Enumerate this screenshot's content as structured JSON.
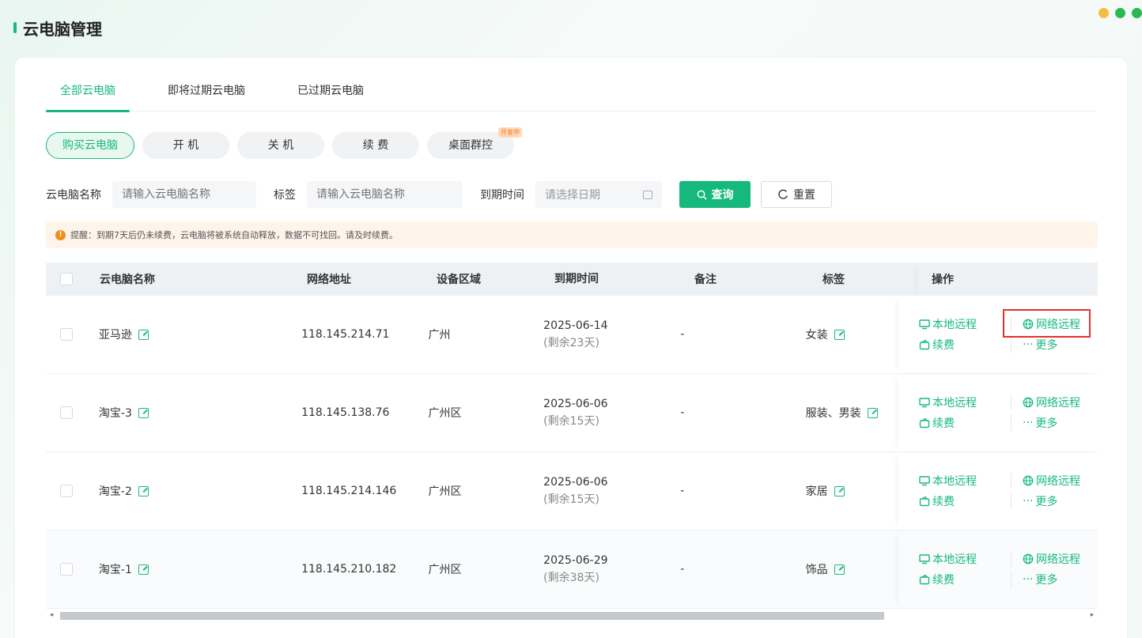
{
  "page_title": "云电脑管理",
  "window_dots": [
    "#f6bd44",
    "#2ab950",
    "#2ab950"
  ],
  "accent": "#16b97d",
  "tabs": [
    {
      "label": "全部云电脑",
      "active": true
    },
    {
      "label": "即将过期云电脑",
      "active": false
    },
    {
      "label": "已过期云电脑",
      "active": false
    }
  ],
  "actions": {
    "buy": "购买云电脑",
    "power_on": "开 机",
    "power_off": "关 机",
    "renew": "续 费",
    "desktop_group": "桌面群控",
    "dev_badge": "开发中"
  },
  "filters": {
    "name_label": "云电脑名称",
    "name_placeholder": "请输入云电脑名称",
    "tag_label": "标签",
    "tag_placeholder": "请输入云电脑名称",
    "expire_label": "到期时间",
    "expire_placeholder": "请选择日期",
    "search_button": "查询",
    "reset_button": "重置"
  },
  "notice": "提醒：到期7天后仍未续费，云电脑将被系统自动释放，数据不可找回。请及时续费。",
  "table": {
    "headers": {
      "name": "云电脑名称",
      "ip": "网络地址",
      "region": "设备区域",
      "expire": "到期时间",
      "note": "备注",
      "tag": "标签",
      "ops": "操作"
    },
    "rows": [
      {
        "name": "亚马逊",
        "ip": "118.145.214.71",
        "region": "广州",
        "date": "2025-06-14",
        "remaining": "(剩余23天)",
        "note": "-",
        "tag": "女装"
      },
      {
        "name": "淘宝-3",
        "ip": "118.145.138.76",
        "region": "广州区",
        "date": "2025-06-06",
        "remaining": "(剩余15天)",
        "note": "-",
        "tag": "服装、男装"
      },
      {
        "name": "淘宝-2",
        "ip": "118.145.214.146",
        "region": "广州区",
        "date": "2025-06-06",
        "remaining": "(剩余15天)",
        "note": "-",
        "tag": "家居"
      },
      {
        "name": "淘宝-1",
        "ip": "118.145.210.182",
        "region": "广州区",
        "date": "2025-06-29",
        "remaining": "(剩余38天)",
        "note": "-",
        "tag": "饰品"
      }
    ],
    "ops": {
      "local_remote": "本地远程",
      "net_remote": "网络远程",
      "renew": "续费",
      "more": "更多"
    }
  }
}
